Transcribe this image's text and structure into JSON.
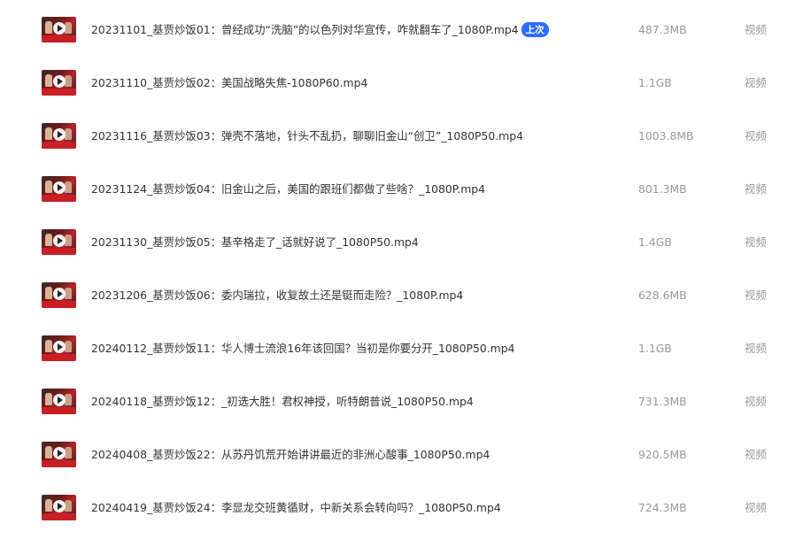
{
  "files": [
    {
      "name": "20231101_基贾炒饭01：曾经成功“洗脑”的以色列对华宣传，咋就翻车了_1080P.mp4",
      "badge": "上次",
      "size": "487.3MB",
      "type": "视频"
    },
    {
      "name": "20231110_基贾炒饭02：美国战略失焦-1080P60.mp4",
      "badge": "",
      "size": "1.1GB",
      "type": "视频"
    },
    {
      "name": "20231116_基贾炒饭03：弹壳不落地，针头不乱扔，聊聊旧金山“创卫”_1080P50.mp4",
      "badge": "",
      "size": "1003.8MB",
      "type": "视频"
    },
    {
      "name": "20231124_基贾炒饭04：旧金山之后，美国的跟班们都做了些啥？_1080P.mp4",
      "badge": "",
      "size": "801.3MB",
      "type": "视频"
    },
    {
      "name": "20231130_基贾炒饭05：基辛格走了_话就好说了_1080P50.mp4",
      "badge": "",
      "size": "1.4GB",
      "type": "视频"
    },
    {
      "name": "20231206_基贾炒饭06：委内瑞拉，收复故土还是铤而走险？_1080P.mp4",
      "badge": "",
      "size": "628.6MB",
      "type": "视频"
    },
    {
      "name": "20240112_基贾炒饭11：华人博士流浪16年该回国？当初是你要分开_1080P50.mp4",
      "badge": "",
      "size": "1.1GB",
      "type": "视频"
    },
    {
      "name": "20240118_基贾炒饭12：_初选大胜！君权神授，听特朗普说_1080P50.mp4",
      "badge": "",
      "size": "731.3MB",
      "type": "视频"
    },
    {
      "name": "20240408_基贾炒饭22：从苏丹饥荒开始讲讲最近的非洲心酸事_1080P50.mp4",
      "badge": "",
      "size": "920.5MB",
      "type": "视频"
    },
    {
      "name": "20240419_基贾炒饭24：李显龙交班黄循财，中新关系会转向吗？_1080P50.mp4",
      "badge": "",
      "size": "724.3MB",
      "type": "视频"
    }
  ]
}
